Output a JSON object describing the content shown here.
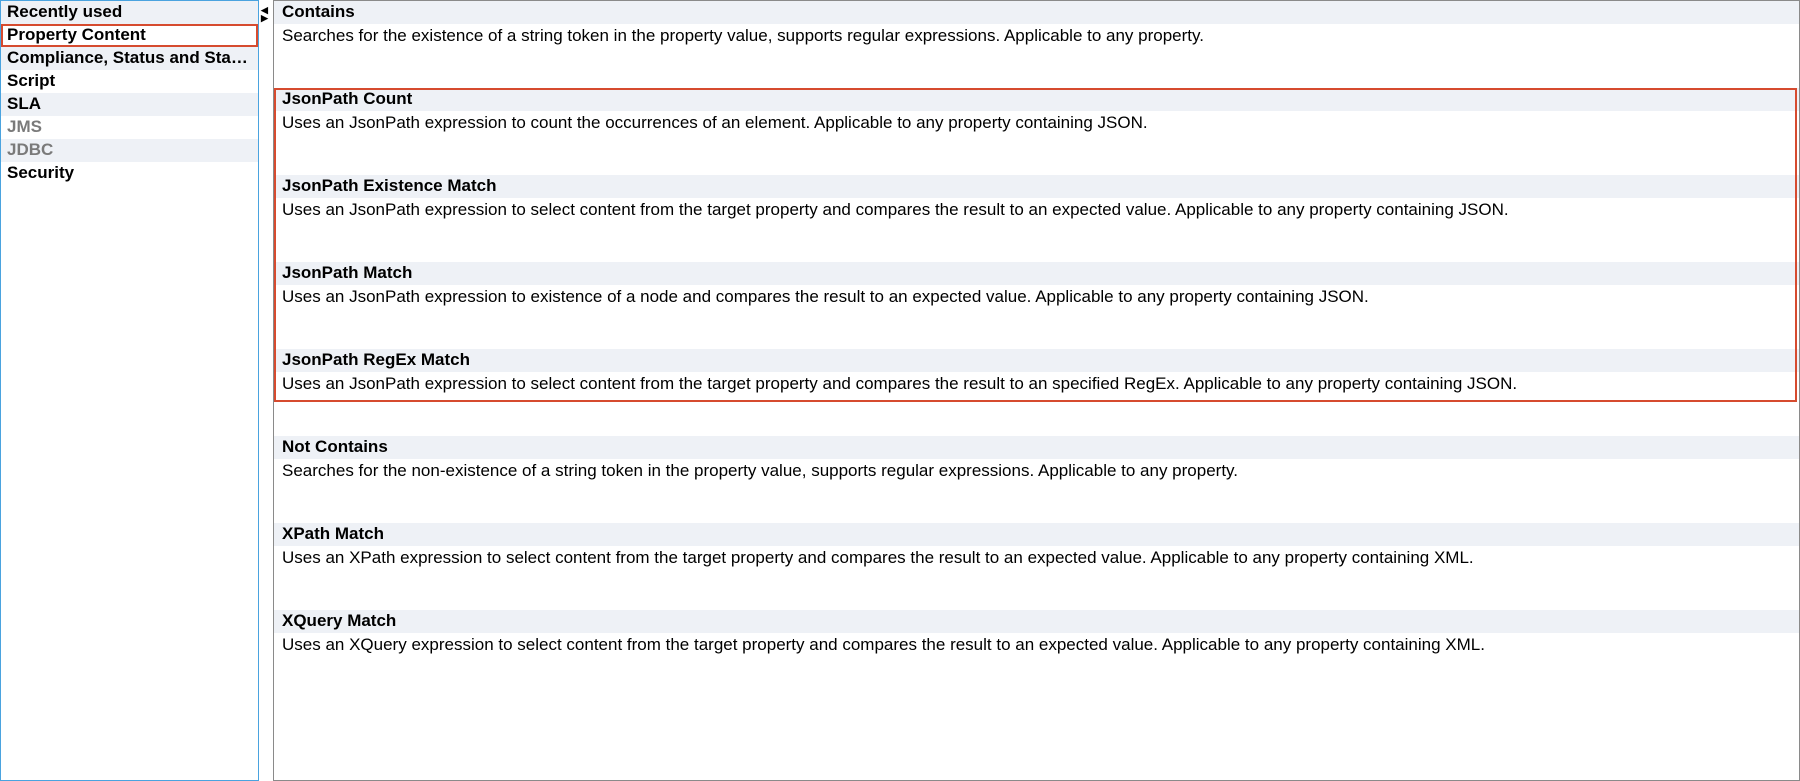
{
  "sidebar": {
    "items": [
      {
        "label": "Recently used",
        "alt": true,
        "dim": false
      },
      {
        "label": "Property Content",
        "alt": false,
        "dim": false,
        "selected": true
      },
      {
        "label": "Compliance, Status and Standards",
        "alt": true,
        "dim": false
      },
      {
        "label": "Script",
        "alt": false,
        "dim": false
      },
      {
        "label": "SLA",
        "alt": true,
        "dim": false
      },
      {
        "label": "JMS",
        "alt": false,
        "dim": true
      },
      {
        "label": "JDBC",
        "alt": true,
        "dim": true
      },
      {
        "label": "Security",
        "alt": false,
        "dim": false
      }
    ]
  },
  "entries": [
    {
      "title": "Contains",
      "desc": "Searches for the existence of a string token in the property value, supports regular expressions. Applicable to any property."
    },
    {
      "title": "JsonPath Count",
      "desc": "Uses an JsonPath expression to count the occurrences of an element. Applicable to any property containing JSON."
    },
    {
      "title": "JsonPath Existence Match",
      "desc": "Uses an JsonPath expression to select content from the target property and compares the result to an expected value. Applicable to any property containing JSON."
    },
    {
      "title": "JsonPath Match",
      "desc": "Uses an JsonPath expression to existence of a node and compares the result to an expected value. Applicable to any property containing JSON."
    },
    {
      "title": "JsonPath RegEx Match",
      "desc": "Uses an JsonPath expression to select content from the target property and compares the result to an specified RegEx. Applicable to any property containing JSON."
    },
    {
      "title": "Not Contains",
      "desc": "Searches for the non-existence of a string token in the property value, supports regular expressions. Applicable to any property."
    },
    {
      "title": "XPath Match",
      "desc": "Uses an XPath expression to select content from the target property and compares the result to an expected value. Applicable to any property containing XML."
    },
    {
      "title": "XQuery Match",
      "desc": "Uses an XQuery expression to select content from the target property and compares the result to an expected value. Applicable to any property containing XML."
    }
  ],
  "splitter_glyphs": {
    "left": "◀",
    "right": "▶"
  }
}
